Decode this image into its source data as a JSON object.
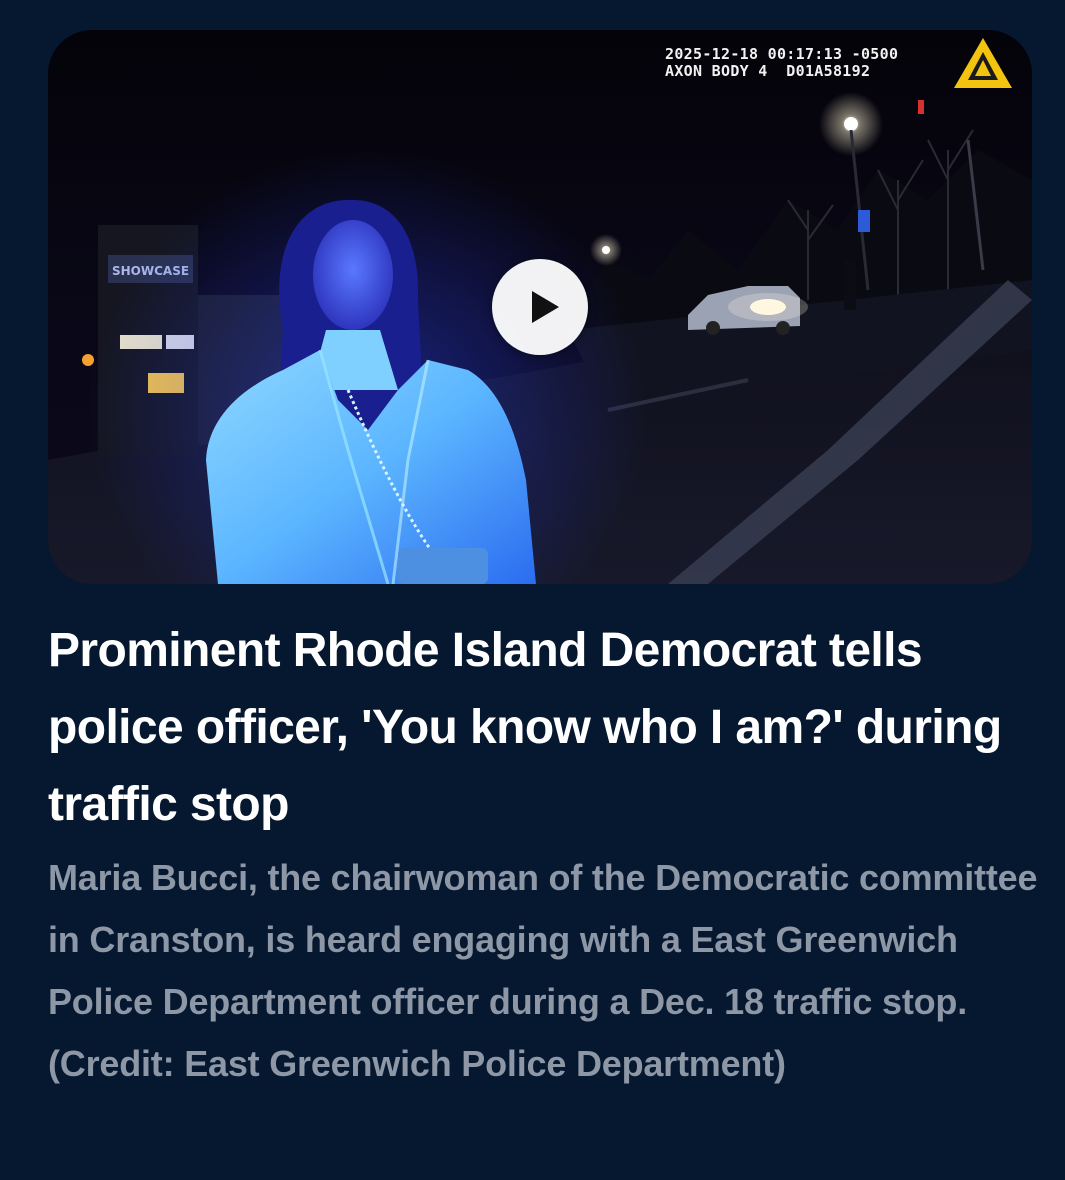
{
  "video": {
    "timestamp": "2025-12-18 00:17:13 -0500",
    "device": "AXON BODY 4  D01A58192",
    "play_icon": "play-icon",
    "logo_icon": "axon-logo-icon",
    "accent_color": "#f2c40f"
  },
  "article": {
    "headline": "Prominent Rhode Island Democrat tells police officer, 'You know who I am?' during traffic stop",
    "caption": "Maria Bucci, the chairwoman of the Democratic committee in Cranston, is heard engaging with a East Greenwich Police Department officer during a Dec. 18 traffic stop. (Credit: East Greenwich Police Department)"
  },
  "colors": {
    "background": "#061830",
    "headline": "#ffffff",
    "caption": "#8d97a5"
  }
}
